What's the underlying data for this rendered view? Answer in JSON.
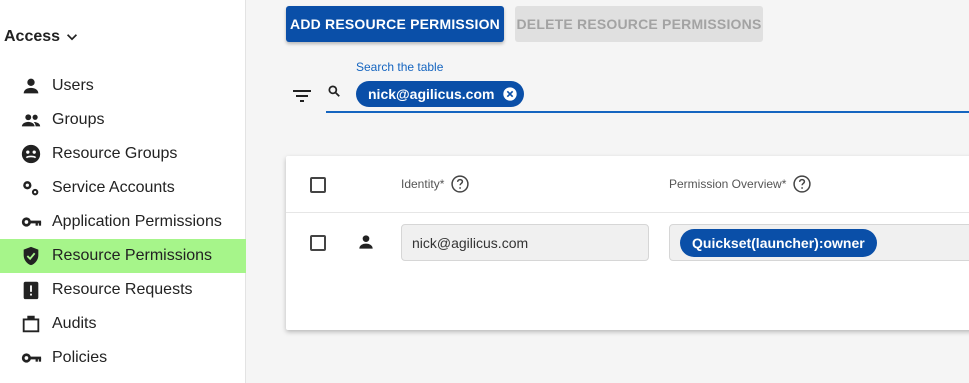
{
  "sidebar": {
    "section_title": "Access",
    "items": [
      {
        "label": "Users",
        "icon": "person-icon",
        "active": false
      },
      {
        "label": "Groups",
        "icon": "group-icon",
        "active": false
      },
      {
        "label": "Resource Groups",
        "icon": "resource-groups-icon",
        "active": false
      },
      {
        "label": "Service Accounts",
        "icon": "service-accounts-icon",
        "active": false
      },
      {
        "label": "Application Permissions",
        "icon": "key-icon",
        "active": false
      },
      {
        "label": "Resource Permissions",
        "icon": "shield-check-icon",
        "active": true
      },
      {
        "label": "Resource Requests",
        "icon": "request-icon",
        "active": false
      },
      {
        "label": "Audits",
        "icon": "briefcase-icon",
        "active": false
      },
      {
        "label": "Policies",
        "icon": "key-icon",
        "active": false
      }
    ]
  },
  "toolbar": {
    "add_label": "ADD RESOURCE PERMISSION",
    "delete_label": "DELETE RESOURCE PERMISSIONS"
  },
  "search": {
    "label": "Search the table",
    "chip": "nick@agilicus.com"
  },
  "table": {
    "headers": {
      "identity": "Identity*",
      "permission": "Permission Overview*"
    },
    "rows": [
      {
        "identity": "nick@agilicus.com",
        "permission": "Quickset(launcher):owner"
      }
    ]
  },
  "colors": {
    "primary": "#0a4fa8",
    "active_nav": "#a6f58a",
    "disabled_button": "#e0e0e0"
  }
}
